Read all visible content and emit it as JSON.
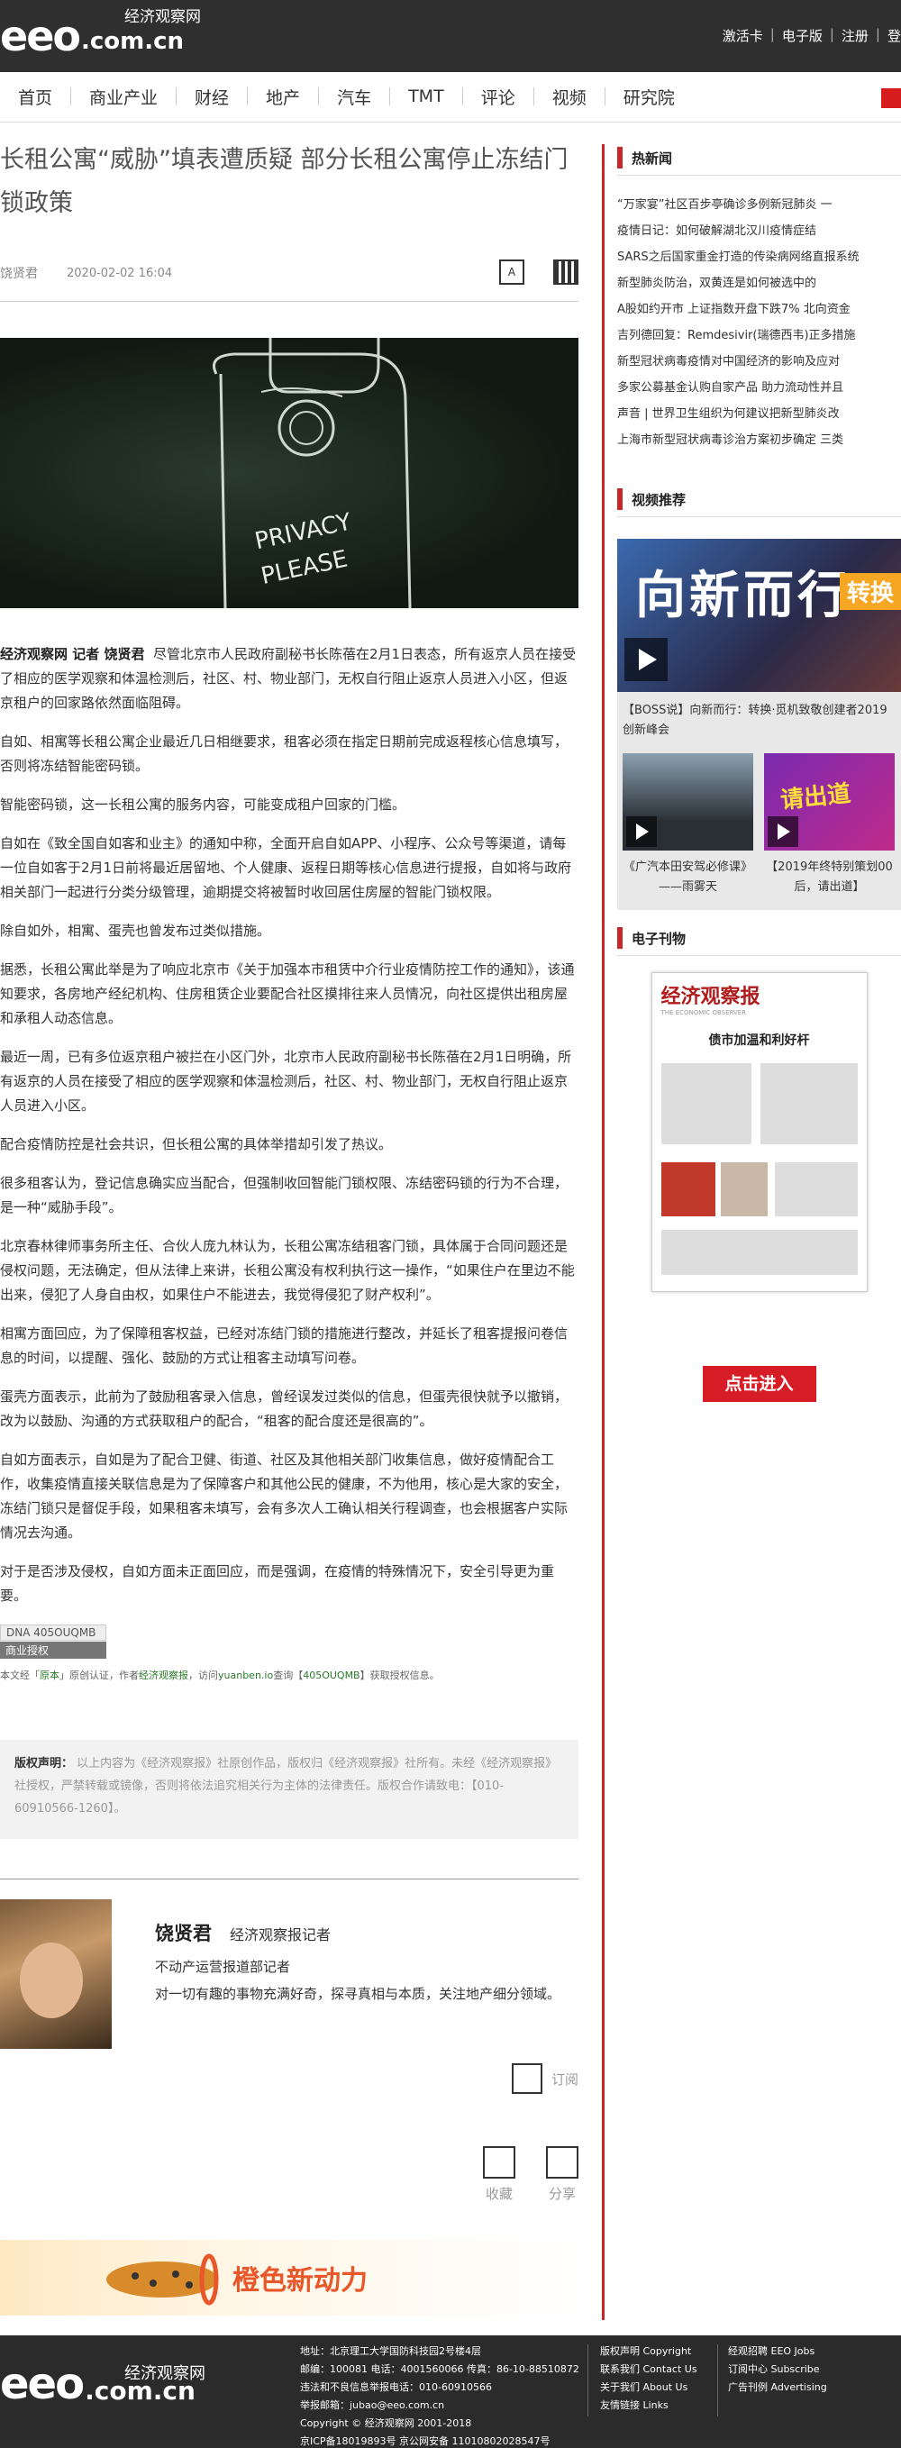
{
  "header": {
    "logo_text": "eeo",
    "logo_domain": ".com.cn",
    "logo_cn": "经济观察网",
    "links": [
      "激活卡",
      "电子版",
      "注册",
      "登"
    ]
  },
  "nav": {
    "items": [
      "首页",
      "商业产业",
      "财经",
      "地产",
      "汽车",
      "TMT",
      "评论",
      "视频",
      "研究院"
    ]
  },
  "article": {
    "title": "长租公寓“威胁”填表遭质疑 部分长租公寓停止冻结门锁政策",
    "author": "饶贤君",
    "date": "2020-02-02 16:04",
    "icon_font_label": "A",
    "hero_text_line1": "PRIVACY",
    "hero_text_line2": "PLEASE",
    "lead_prefix": "经济观察网 记者 饶贤君",
    "lead_text": "尽管北京市人民政府副秘书长陈蓓在2月1日表态，所有返京人员在接受了相应的医学观察和体温检测后，社区、村、物业部门，无权自行阻止返京人员进入小区，但返京租户的回家路依然面临阻碍。",
    "paragraphs": [
      "自如、相寓等长租公寓企业最近几日相继要求，租客必须在指定日期前完成返程核心信息填写，否则将冻结智能密码锁。",
      "智能密码锁，这一长租公寓的服务内容，可能变成租户回家的门槛。",
      "自如在《致全国自如客和业主》的通知中称，全面开启自如APP、小程序、公众号等渠道，请每一位自如客于2月1日前将最近居留地、个人健康、返程日期等核心信息进行提报，自如将与政府相关部门一起进行分类分级管理，逾期提交将被暂时收回居住房屋的智能门锁权限。",
      "除自如外，相寓、蛋壳也曾发布过类似措施。",
      "据悉，长租公寓此举是为了响应北京市《关于加强本市租赁中介行业疫情防控工作的通知》，该通知要求，各房地产经纪机构、住房租赁企业要配合社区摸排往来人员情况，向社区提供出租房屋和承租人动态信息。",
      "最近一周，已有多位返京租户被拦在小区门外，北京市人民政府副秘书长陈蓓在2月1日明确，所有返京的人员在接受了相应的医学观察和体温检测后，社区、村、物业部门，无权自行阻止返京人员进入小区。",
      "配合疫情防控是社会共识，但长租公寓的具体举措却引发了热议。",
      "很多租客认为，登记信息确实应当配合，但强制收回智能门锁权限、冻结密码锁的行为不合理，是一种“威胁手段”。",
      "北京春林律师事务所主任、合伙人庞九林认为，长租公寓冻结租客门锁，具体属于合同问题还是侵权问题，无法确定，但从法律上来讲，长租公寓没有权利执行这一操作，“如果住户在里边不能出来，侵犯了人身自由权，如果住户不能进去，我觉得侵犯了财产权利”。",
      "相寓方面回应，为了保障租客权益，已经对冻结门锁的措施进行整改，并延长了租客提报问卷信息的时间，以提醒、强化、鼓励的方式让租客主动填写问卷。",
      "蛋壳方面表示，此前为了鼓励租客录入信息，曾经误发过类似的信息，但蛋壳很快就予以撤销，改为以鼓励、沟通的方式获取租户的配合，“租客的配合度还是很高的”。",
      "自如方面表示，自如是为了配合卫健、街道、社区及其他相关部门收集信息，做好疫情配合工作，收集疫情直接关联信息是为了保障客户和其他公民的健康，不为他用，核心是大家的安全，冻结门锁只是督促手段，如果租客未填写，会有多次人工确认相关行程调查，也会根据客户实际情况去沟通。",
      "对于是否涉及侵权，自如方面未正面回应，而是强调，在疫情的特殊情况下，安全引导更为重要。"
    ],
    "dna_code": "DNA 405OUQMB",
    "dna_label": "商业授权",
    "rights_note_pre": "本文经「",
    "rights_note_orig": "原本",
    "rights_note_mid": "」原创认证，作者",
    "rights_note_author": "经济观察报",
    "rights_note_mid2": "，访问",
    "rights_note_site": "yuanben.io",
    "rights_note_mid3": "查询【",
    "rights_note_code": "405OUQMB",
    "rights_note_end": "】获取授权信息。",
    "copyright_label": "版权声明：",
    "copyright_text": "以上内容为《经济观察报》社原创作品，版权归《经济观察报》社所有。未经《经济观察报》社授权，严禁转载或镜像，否则将依法追究相关行为主体的法律责任。版权合作请致电：【010-60910566-1260】。"
  },
  "author_card": {
    "name": "饶贤君",
    "role": "经济观察报记者",
    "desk": "不动产运营报道部记者",
    "bio": "对一切有趣的事物充满好奇，探寻真相与本质，关注地产细分领域。",
    "subscribe_label": "订阅",
    "favorite_label": "收藏",
    "share_label": "分享"
  },
  "banner": {
    "text": "橙色新动力"
  },
  "sidebar": {
    "hot_title": "热新闻",
    "hot_news": [
      "“万家宴”社区百步亭确诊多例新冠肺炎 一",
      "疫情日记：如何破解湖北汉川疫情症结",
      "SARS之后国家重金打造的传染病网络直报系统",
      "新型肺炎防治，双黄连是如何被选中的",
      "A股如约开市 上证指数开盘下跌7% 北向资金",
      "吉列德回复：Remdesivir(瑞德西韦)正多措施",
      "新型冠状病毒疫情对中国经济的影响及应对",
      "多家公募基金认购自家产品 助力流动性并且",
      "声音 | 世界卫生组织为何建议把新型肺炎改",
      "上海市新型冠状病毒诊治方案初步确定 三类"
    ],
    "video_title": "视频推荐",
    "video_main_text": "向新而行",
    "video_main_badge": "转换",
    "video_main_caption": "【BOSS说】向新而行：转换·觅机致敬创建者2019创新峰会",
    "video_items": [
      {
        "caption": "《广汽本田安驾必修课》——雨雾天"
      },
      {
        "caption": "【2019年终特别策划00后，请出道】",
        "thumb_text": "请出道"
      }
    ],
    "epaper_title": "电子刊物",
    "epaper_masthead": "经济观察报",
    "epaper_sub": "THE ECONOMIC OBSERVER",
    "epaper_headline": "债市加温和利好杆",
    "epaper_button": "点击进入"
  },
  "footer": {
    "logo_text": "eeo",
    "logo_domain": ".com.cn",
    "logo_cn": "经济观察网",
    "info_lines": [
      "地址：北京理工大学国防科技园2号楼4层",
      "邮编：100081 电话：4001560066 传真：86-10-88510872",
      "违法和不良信息举报电话：010-60910566",
      "举报邮箱：jubao@eeo.com.cn",
      "Copyright © 经济观察网 2001-2018",
      "京ICP备18019893号    京公网安备 11010802028547号"
    ],
    "col1": [
      "版权声明 Copyright",
      "联系我们 Contact Us",
      "关于我们 About Us",
      "友情链接 Links"
    ],
    "col2": [
      "经观招聘 EEO Jobs",
      "订阅中心 Subscribe",
      "广告刊例 Advertising"
    ]
  }
}
